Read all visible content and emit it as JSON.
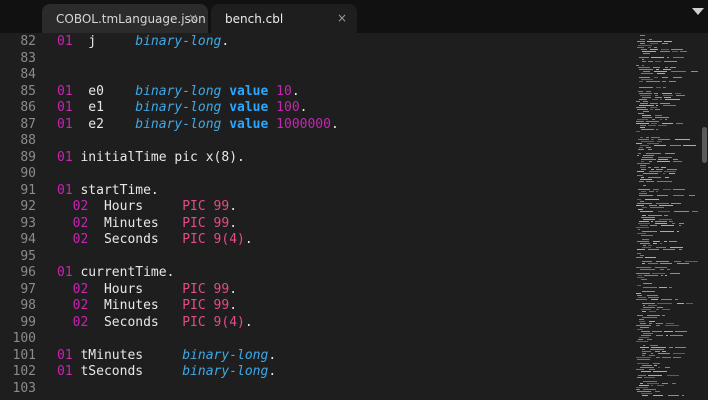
{
  "tabs": [
    {
      "label": "COBOL.tmLanguage.json",
      "close": "×",
      "active": false
    },
    {
      "label": "bench.cbl",
      "close": "×",
      "active": true
    }
  ],
  "lines": [
    {
      "num": "82",
      "tokens": [
        [
          "lvl",
          "01"
        ],
        [
          "txt",
          "  j     "
        ],
        [
          "typ",
          "binary-long"
        ],
        [
          "txt",
          "."
        ]
      ]
    },
    {
      "num": "83",
      "tokens": []
    },
    {
      "num": "84",
      "tokens": []
    },
    {
      "num": "85",
      "tokens": [
        [
          "lvl",
          "01"
        ],
        [
          "txt",
          "  e0    "
        ],
        [
          "typ",
          "binary-long"
        ],
        [
          "txt",
          " "
        ],
        [
          "kw",
          "value"
        ],
        [
          "txt",
          " "
        ],
        [
          "num",
          "10"
        ],
        [
          "txt",
          "."
        ]
      ]
    },
    {
      "num": "86",
      "tokens": [
        [
          "lvl",
          "01"
        ],
        [
          "txt",
          "  e1    "
        ],
        [
          "typ",
          "binary-long"
        ],
        [
          "txt",
          " "
        ],
        [
          "kw",
          "value"
        ],
        [
          "txt",
          " "
        ],
        [
          "num",
          "100"
        ],
        [
          "txt",
          "."
        ]
      ]
    },
    {
      "num": "87",
      "tokens": [
        [
          "lvl",
          "01"
        ],
        [
          "txt",
          "  e2    "
        ],
        [
          "typ",
          "binary-long"
        ],
        [
          "txt",
          " "
        ],
        [
          "kw",
          "value"
        ],
        [
          "txt",
          " "
        ],
        [
          "num",
          "1000000"
        ],
        [
          "txt",
          "."
        ]
      ]
    },
    {
      "num": "88",
      "tokens": []
    },
    {
      "num": "89",
      "tokens": [
        [
          "lvl",
          "01"
        ],
        [
          "txt",
          " initialTime pic x(8)."
        ]
      ]
    },
    {
      "num": "90",
      "tokens": []
    },
    {
      "num": "91",
      "tokens": [
        [
          "lvl",
          "01"
        ],
        [
          "txt",
          " startTime."
        ]
      ]
    },
    {
      "num": "92",
      "tokens": [
        [
          "txt",
          "  "
        ],
        [
          "lvl",
          "02"
        ],
        [
          "txt",
          "  Hours     "
        ],
        [
          "pic",
          "PIC 99"
        ],
        [
          "txt",
          "."
        ]
      ]
    },
    {
      "num": "93",
      "tokens": [
        [
          "txt",
          "  "
        ],
        [
          "lvl",
          "02"
        ],
        [
          "txt",
          "  Minutes   "
        ],
        [
          "pic",
          "PIC 99"
        ],
        [
          "txt",
          "."
        ]
      ]
    },
    {
      "num": "94",
      "tokens": [
        [
          "txt",
          "  "
        ],
        [
          "lvl",
          "02"
        ],
        [
          "txt",
          "  Seconds   "
        ],
        [
          "pic",
          "PIC 9(4)"
        ],
        [
          "txt",
          "."
        ]
      ]
    },
    {
      "num": "95",
      "tokens": []
    },
    {
      "num": "96",
      "tokens": [
        [
          "lvl",
          "01"
        ],
        [
          "txt",
          " currentTime."
        ]
      ]
    },
    {
      "num": "97",
      "tokens": [
        [
          "txt",
          "  "
        ],
        [
          "lvl",
          "02"
        ],
        [
          "txt",
          "  Hours     "
        ],
        [
          "pic",
          "PIC 99"
        ],
        [
          "txt",
          "."
        ]
      ]
    },
    {
      "num": "98",
      "tokens": [
        [
          "txt",
          "  "
        ],
        [
          "lvl",
          "02"
        ],
        [
          "txt",
          "  Minutes   "
        ],
        [
          "pic",
          "PIC 99"
        ],
        [
          "txt",
          "."
        ]
      ]
    },
    {
      "num": "99",
      "tokens": [
        [
          "txt",
          "  "
        ],
        [
          "lvl",
          "02"
        ],
        [
          "txt",
          "  Seconds   "
        ],
        [
          "pic",
          "PIC 9(4)"
        ],
        [
          "txt",
          "."
        ]
      ]
    },
    {
      "num": "100",
      "tokens": []
    },
    {
      "num": "101",
      "tokens": [
        [
          "lvl",
          "01"
        ],
        [
          "txt",
          " tMinutes     "
        ],
        [
          "typ",
          "binary-long"
        ],
        [
          "txt",
          "."
        ]
      ]
    },
    {
      "num": "102",
      "tokens": [
        [
          "lvl",
          "01"
        ],
        [
          "txt",
          " tSeconds     "
        ],
        [
          "typ",
          "binary-long"
        ],
        [
          "txt",
          "."
        ]
      ]
    },
    {
      "num": "103",
      "tokens": []
    }
  ],
  "colors": {
    "level": "#c724b1",
    "type": "#3fa9e6",
    "keyword": "#2aa7ff",
    "pic": "#e34b8a",
    "text": "#e8e8e8",
    "gutter": "#8b8b8b",
    "background": "#1e1e1e"
  },
  "icons": {
    "tab_close": "close-icon",
    "tab_overflow": "chevron-down-icon"
  }
}
